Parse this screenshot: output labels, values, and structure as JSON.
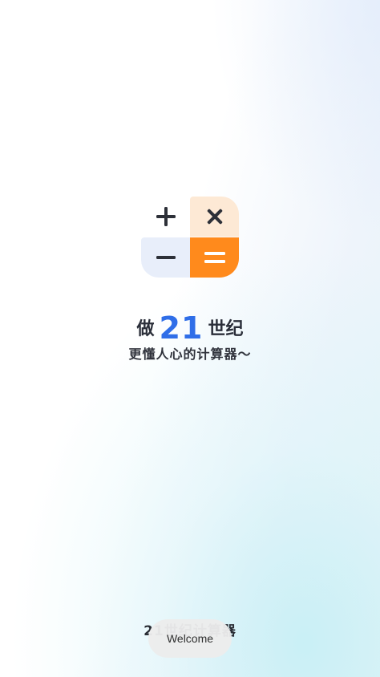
{
  "splash": {
    "logo": {
      "plus_symbol": "+",
      "times_symbol": "×",
      "minus_symbol": "−",
      "equals_symbol": "="
    },
    "headline": {
      "prefix": "做",
      "number": "21",
      "suffix": "世纪"
    },
    "slogan": "更懂人心的计算器～",
    "app_name": "21世纪计算器"
  },
  "toast": {
    "message": "Welcome"
  },
  "colors": {
    "accent_blue": "#2f6ee8",
    "accent_orange": "#ff8a1c",
    "tile_peach": "#fde9d5",
    "tile_lavender": "#e8eefa",
    "text_dark": "#2b2f3a"
  }
}
